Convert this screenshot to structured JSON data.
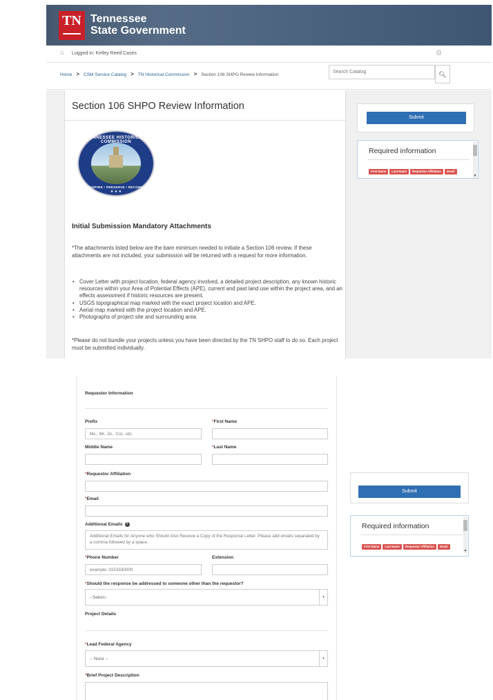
{
  "header": {
    "logo_abbr": "TN",
    "brand_line1": "Tennessee",
    "brand_line2": "State Government"
  },
  "userbar": {
    "logged_in": "Logged in: Kelley Reed",
    "cases": "Cases"
  },
  "breadcrumb": {
    "items": [
      "Home",
      "CSM Service Catalog",
      "TN Historical Commission",
      "Section 106 SHPO Review Information"
    ],
    "separator": ">"
  },
  "search": {
    "placeholder": "Search Catalog"
  },
  "page": {
    "title": "Section 106 SHPO Review Information"
  },
  "seal": {
    "ring_text": "TENNESSEE HISTORICAL COMMISSION",
    "motto": "INSPIRE • PRESERVE • RECORD",
    "stars": "★ ★ ★"
  },
  "attachments": {
    "heading": "Initial Submission Mandatory Attachments",
    "intro": "*The attachments listed below are the bare minimum needed to initiate a Section 106 review. If these attachments are not included, your submission will be returned with a request for more information.",
    "items": [
      "Cover Letter with project location, federal agency involved, a detailed project description, any known historic resources within your Area of Potential Effects (APE), current and past land use within the project area, and an effects assessment if historic resources are present.",
      "USGS topographical map marked with the exact project location and APE.",
      "Aerial map marked with the project location and APE.",
      "Photographs of project site and surrounding area"
    ],
    "note": "*Please do not bundle your projects unless you have been directed by the TN SHPO staff to do so. Each project must be submitted individually."
  },
  "sidebar": {
    "submit_label": "Submit",
    "required_title": "Required information",
    "required_badges": [
      "First Name",
      "Last Name",
      "Requestor Affiliation",
      "Email"
    ]
  },
  "form": {
    "requestor_section": "Requestor Information",
    "required_marker": "*",
    "prefix_label": "Prefix",
    "prefix_placeholder": "Ms., Mr., Dr., Col., etc.",
    "first_name_label": "First Name",
    "middle_name_label": "Middle Name",
    "last_name_label": "Last Name",
    "affiliation_label": "Requestor Affiliation",
    "email_label": "Email",
    "additional_emails_label": "Additional Emails",
    "additional_emails_placeholder": "Additional Emails for Anyone who Should Also Receive a Copy of the Response Letter. Please add emails separated by a comma followed by a space.",
    "phone_label": "Phone Number",
    "phone_placeholder": "example: 0153330000",
    "extension_label": "Extension",
    "addressed_label": "Should the response be addressed to someone other than the requestor?",
    "addressed_value": "--Select--",
    "project_section": "Project Details",
    "agency_label": "Lead Federal Agency",
    "agency_value": "-- None --",
    "description_label": "Brief Project Description"
  },
  "colors": {
    "banner": "#4d6480",
    "logo_red": "#c9202a",
    "submit_blue": "#2f6fb3",
    "badge_red": "#d9534f",
    "link_blue": "#2a6496"
  }
}
